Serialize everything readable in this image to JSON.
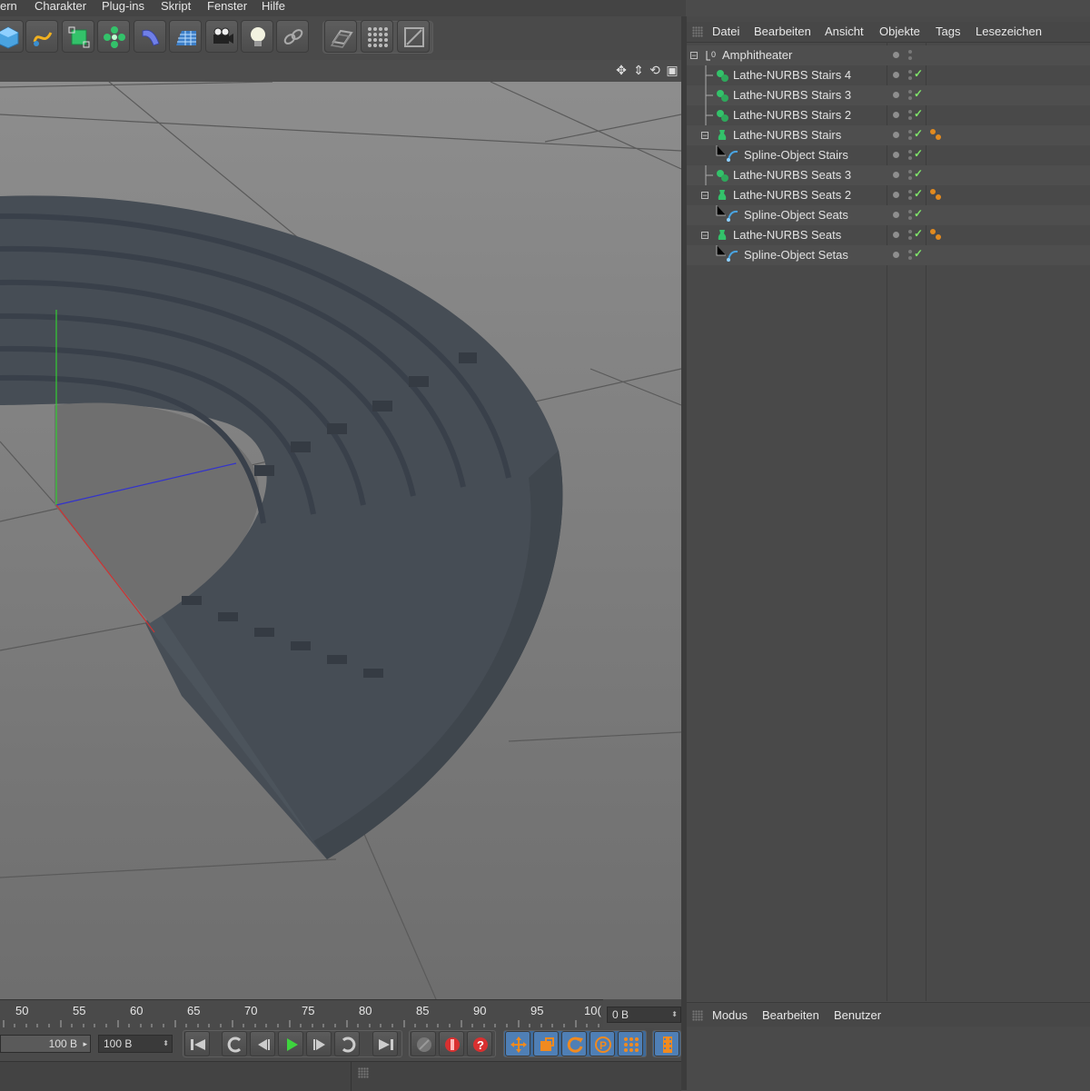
{
  "menubar": {
    "items": [
      "ern",
      "Charakter",
      "Plug-ins",
      "Skript",
      "Fenster",
      "Hilfe"
    ]
  },
  "object_manager": {
    "menu": [
      "Datei",
      "Bearbeiten",
      "Ansicht",
      "Objekte",
      "Tags",
      "Lesezeichen"
    ],
    "objects": [
      {
        "name": "Amphitheater",
        "type": "null"
      },
      {
        "name": "Lathe-NURBS Stairs 4",
        "type": "lathe-instance"
      },
      {
        "name": "Lathe-NURBS Stairs 3",
        "type": "lathe-instance"
      },
      {
        "name": "Lathe-NURBS Stairs 2",
        "type": "lathe-instance"
      },
      {
        "name": "Lathe-NURBS Stairs",
        "type": "lathe"
      },
      {
        "name": "Spline-Object Stairs",
        "type": "spline"
      },
      {
        "name": "Lathe-NURBS Seats 3",
        "type": "lathe-instance"
      },
      {
        "name": "Lathe-NURBS Seats 2",
        "type": "lathe"
      },
      {
        "name": "Spline-Object Seats",
        "type": "spline"
      },
      {
        "name": "Lathe-NURBS Seats",
        "type": "lathe"
      },
      {
        "name": "Spline-Object Setas",
        "type": "spline"
      }
    ]
  },
  "attribute_manager": {
    "menu": [
      "Modus",
      "Bearbeiten",
      "Benutzer"
    ]
  },
  "timeline": {
    "ticks": [
      "50",
      "55",
      "60",
      "65",
      "70",
      "75",
      "80",
      "85",
      "90",
      "95",
      "10("
    ],
    "current_frame": "0 B",
    "end_field_left": "100 B",
    "end_field_right": "100 B"
  },
  "colors": {
    "accent_check": "#7fe36a",
    "tag_orange": "#e28a1f",
    "axis_x": "#c33",
    "axis_y": "#3c3",
    "axis_z": "#33c"
  }
}
